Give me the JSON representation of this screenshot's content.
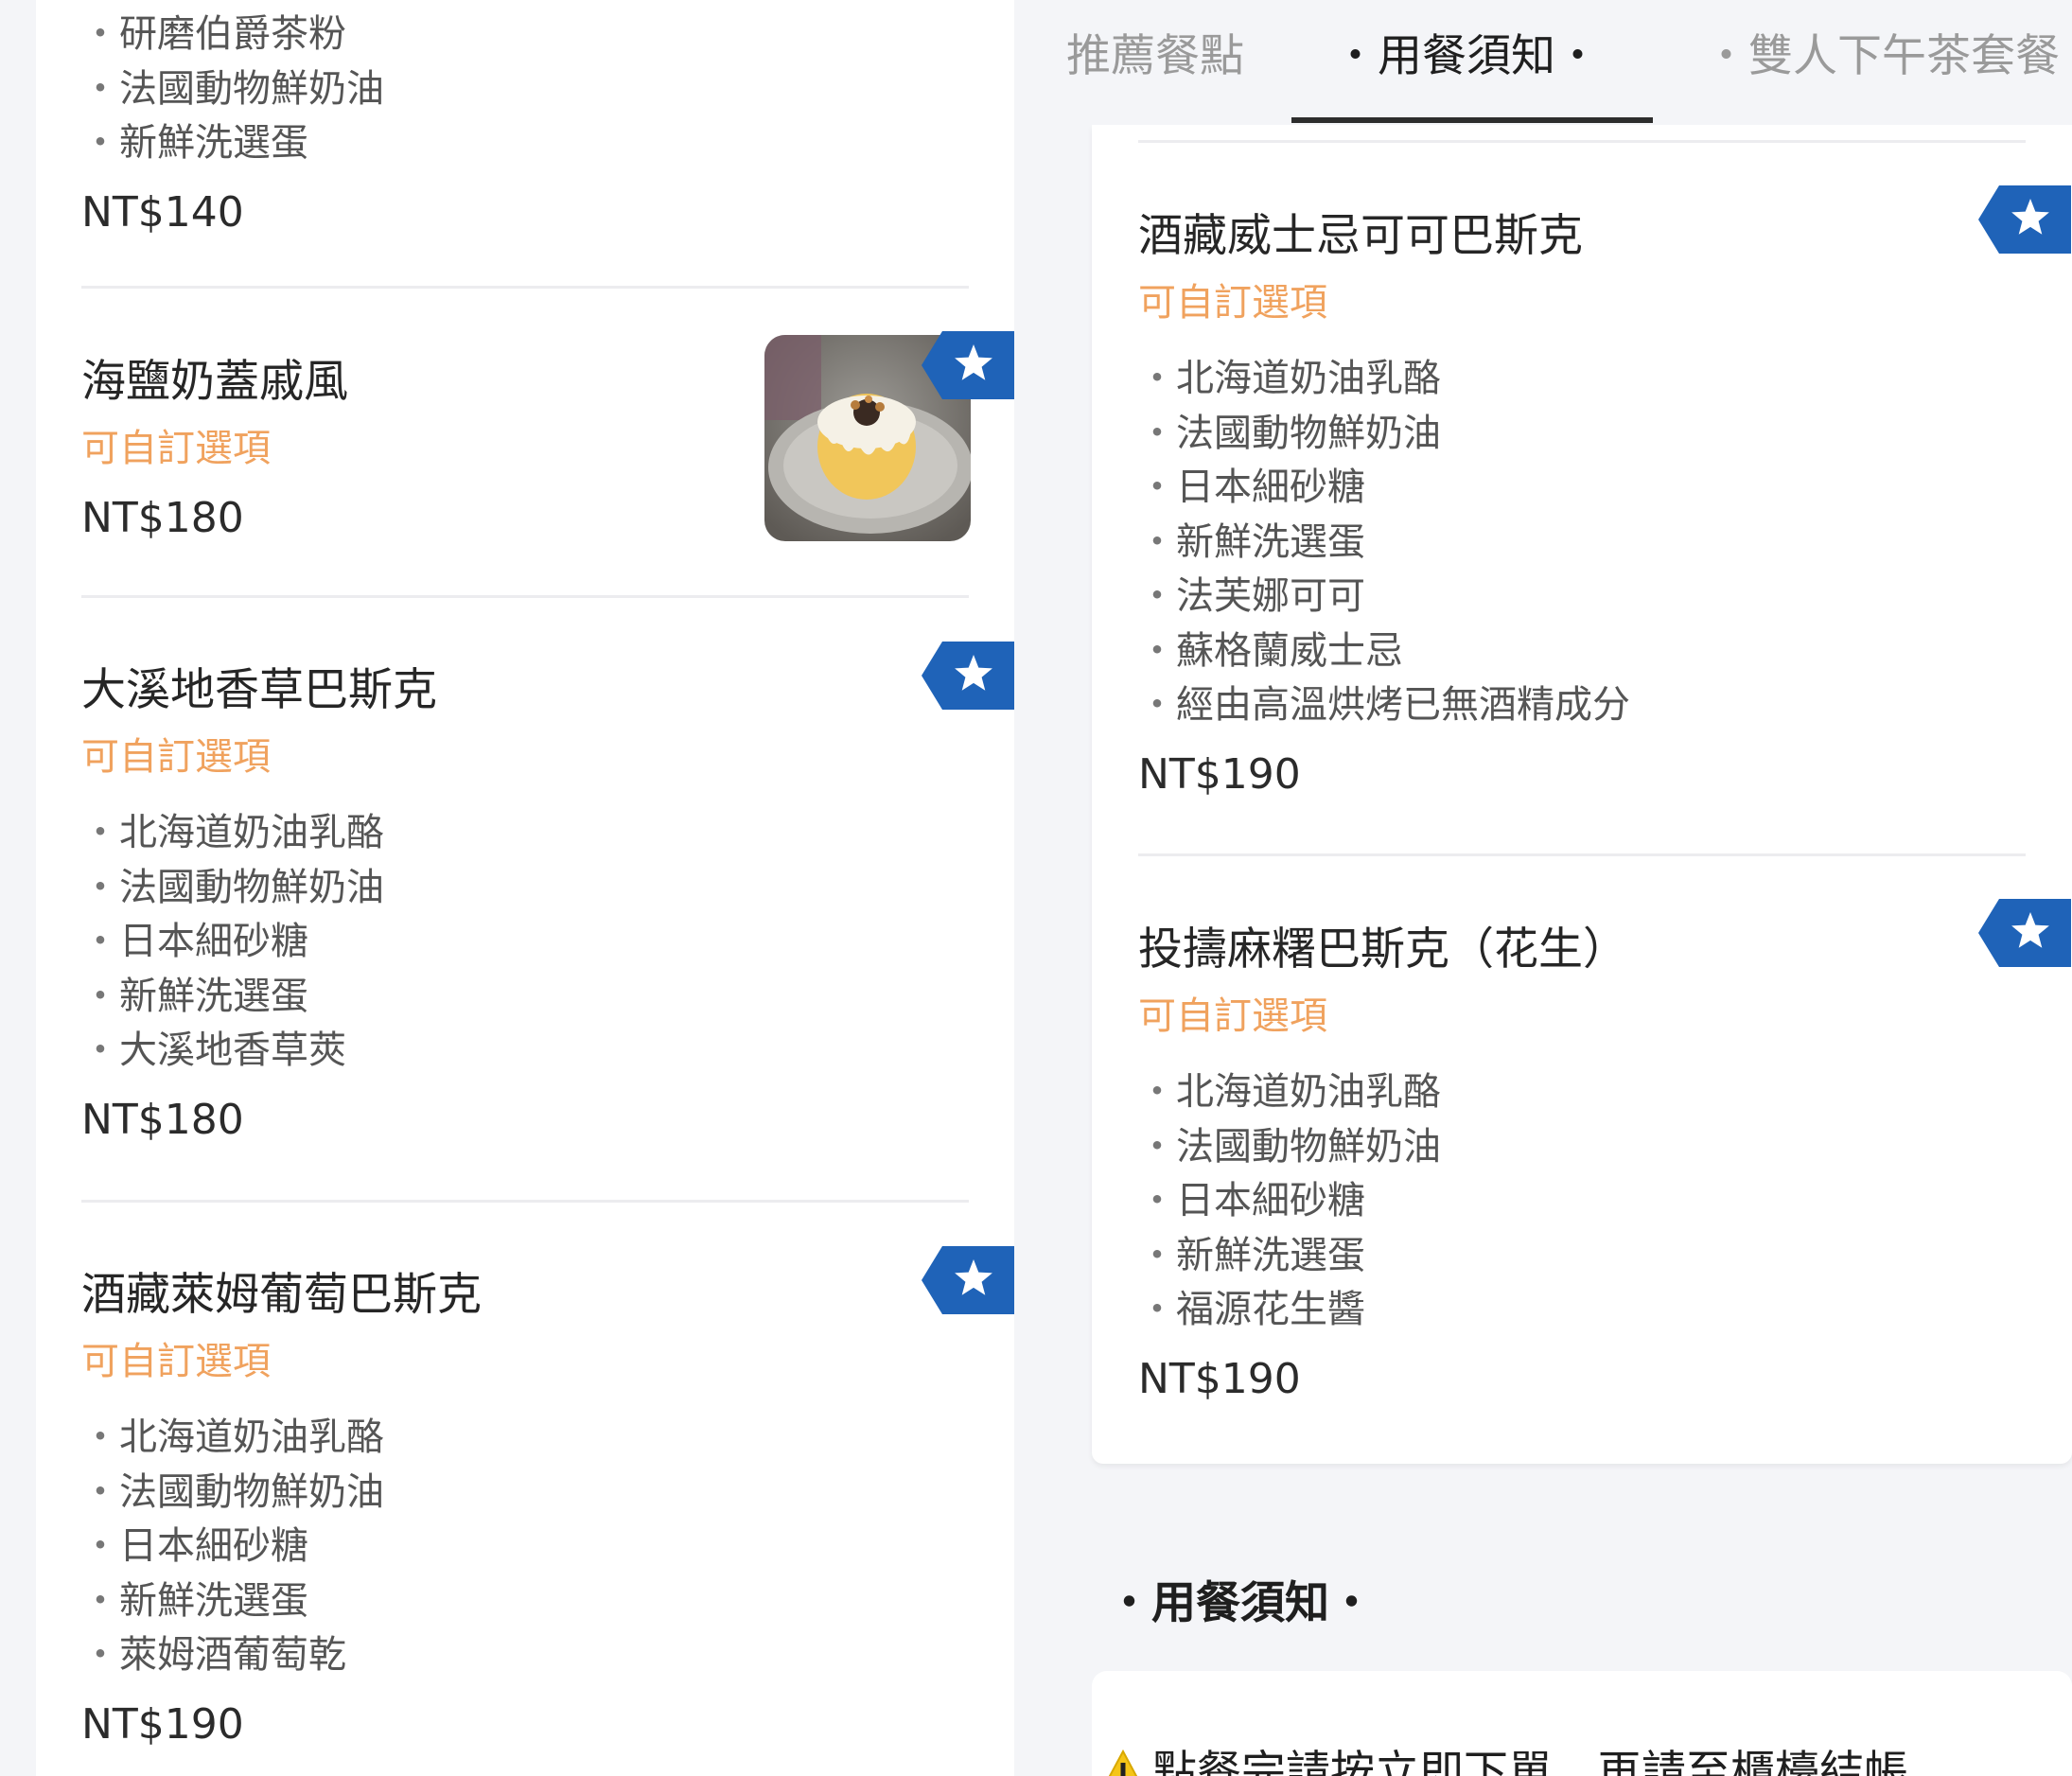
{
  "tabs": [
    {
      "label": "推薦餐點"
    },
    {
      "label": "・用餐須知・"
    },
    {
      "label": "・雙人下午茶套餐"
    }
  ],
  "left_column": {
    "top_item": {
      "ingredients": [
        "研磨伯爵茶粉",
        "法國動物鮮奶油",
        "新鮮洗選蛋"
      ],
      "price": "NT$140"
    },
    "items": [
      {
        "name": "海鹽奶蓋戚風",
        "custom": "可自訂選項",
        "price": "NT$180",
        "featured": true,
        "image": "sea-salt-chiffon-cake-photo"
      },
      {
        "name": "大溪地香草巴斯克",
        "custom": "可自訂選項",
        "ingredients": [
          "北海道奶油乳酪",
          "法國動物鮮奶油",
          "日本細砂糖",
          "新鮮洗選蛋",
          "大溪地香草莢"
        ],
        "price": "NT$180",
        "featured": true
      },
      {
        "name": "酒藏萊姆葡萄巴斯克",
        "custom": "可自訂選項",
        "ingredients": [
          "北海道奶油乳酪",
          "法國動物鮮奶油",
          "日本細砂糖",
          "新鮮洗選蛋",
          "萊姆酒葡萄乾"
        ],
        "price": "NT$190",
        "featured": true
      }
    ]
  },
  "right_column": {
    "items": [
      {
        "name": "酒藏威士忌可可巴斯克",
        "custom": "可自訂選項",
        "ingredients": [
          "北海道奶油乳酪",
          "法國動物鮮奶油",
          "日本細砂糖",
          "新鮮洗選蛋",
          "法芙娜可可",
          "蘇格蘭威士忌",
          "經由高溫烘烤已無酒精成分"
        ],
        "price": "NT$190",
        "featured": true
      },
      {
        "name": "投擣麻糬巴斯克（花生）",
        "custom": "可自訂選項",
        "ingredients": [
          "北海道奶油乳酪",
          "法國動物鮮奶油",
          "日本細砂糖",
          "新鮮洗選蛋",
          "福源花生醬"
        ],
        "price": "NT$190",
        "featured": true
      }
    ],
    "section_heading": "・用餐須知・",
    "notice_text": "點餐完請按立即下單，再請至櫃檯結帳"
  },
  "bullet": "・",
  "icons": {
    "featured": "star-icon",
    "warning": "warning-icon"
  },
  "colors": {
    "accent_orange": "#f0a25e",
    "badge_blue": "#1f63b8",
    "page_bg": "#f4f5f8",
    "tab_active": "#2d2d2d"
  }
}
